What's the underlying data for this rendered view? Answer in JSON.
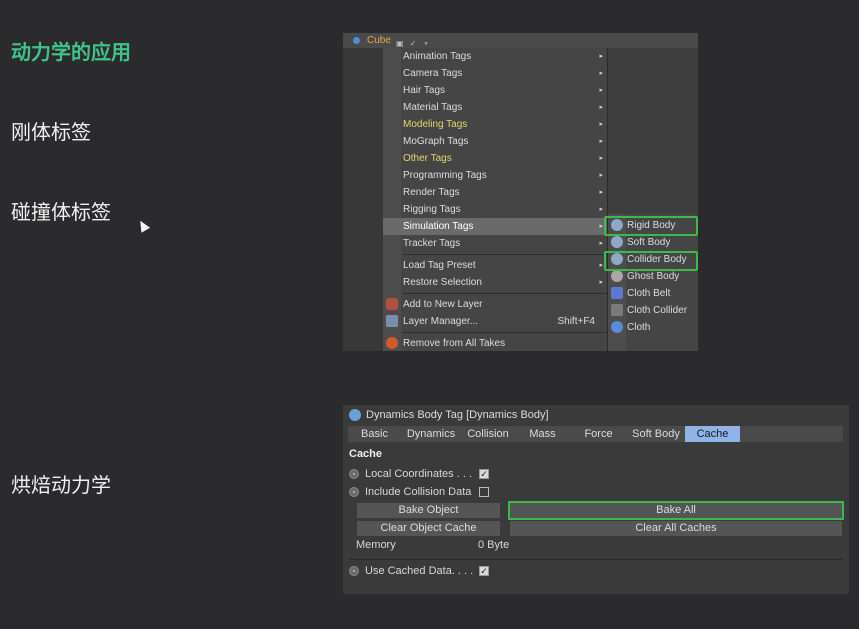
{
  "headings": {
    "title": "动力学的应用",
    "rigid_tag": "刚体标签",
    "collider_tag": "碰撞体标签",
    "bake": "烘焙动力学"
  },
  "object_bar": {
    "object_name": "Cube",
    "icons": "▣ ✓ ⚬"
  },
  "menu": {
    "items": [
      {
        "label": "Animation Tags",
        "arrow": "▸"
      },
      {
        "label": "Camera Tags",
        "arrow": "▸"
      },
      {
        "label": "Hair Tags",
        "arrow": "▸"
      },
      {
        "label": "Material Tags",
        "arrow": "▸"
      },
      {
        "label": "Modeling Tags",
        "arrow": "▸"
      },
      {
        "label": "MoGraph Tags",
        "arrow": "▸"
      },
      {
        "label": "Other Tags",
        "arrow": "▸"
      },
      {
        "label": "Programming Tags",
        "arrow": "▸"
      },
      {
        "label": "Render Tags",
        "arrow": "▸"
      },
      {
        "label": "Rigging Tags",
        "arrow": "▸"
      },
      {
        "label": "Simulation Tags",
        "arrow": "▸"
      },
      {
        "label": "Tracker Tags",
        "arrow": "▸"
      },
      {
        "label": "Load Tag Preset",
        "arrow": "▸"
      },
      {
        "label": "Restore Selection",
        "arrow": "▸"
      },
      {
        "label": "Add to New Layer"
      },
      {
        "label": "Layer Manager...",
        "shortcut": "Shift+F4"
      },
      {
        "label": "Remove from All Takes"
      }
    ]
  },
  "submenu": {
    "items": [
      "Rigid Body",
      "Soft Body",
      "Collider Body",
      "Ghost Body",
      "Cloth Belt",
      "Cloth Collider",
      "Cloth"
    ]
  },
  "attributes": {
    "title": "Dynamics Body Tag [Dynamics Body]",
    "tabs": [
      "Basic",
      "Dynamics",
      "Collision",
      "Mass",
      "Force",
      "Soft Body",
      "Cache"
    ],
    "active_tab": "Cache",
    "section": "Cache",
    "local_coordinates": "Local Coordinates . . .",
    "include_collision": "Include Collision Data",
    "bake_object": "Bake Object",
    "bake_all": "Bake All",
    "clear_object_cache": "Clear Object Cache",
    "clear_all_caches": "Clear All Caches",
    "memory_label": "Memory",
    "memory_value": "0 Byte",
    "use_cached_data": "Use Cached Data. . . ."
  },
  "colors": {
    "title_green": "#3fc38c",
    "highlight_green": "#3cb94a",
    "active_tab_blue": "#8fb4e8",
    "menu_yellow": "#e6d66a"
  }
}
